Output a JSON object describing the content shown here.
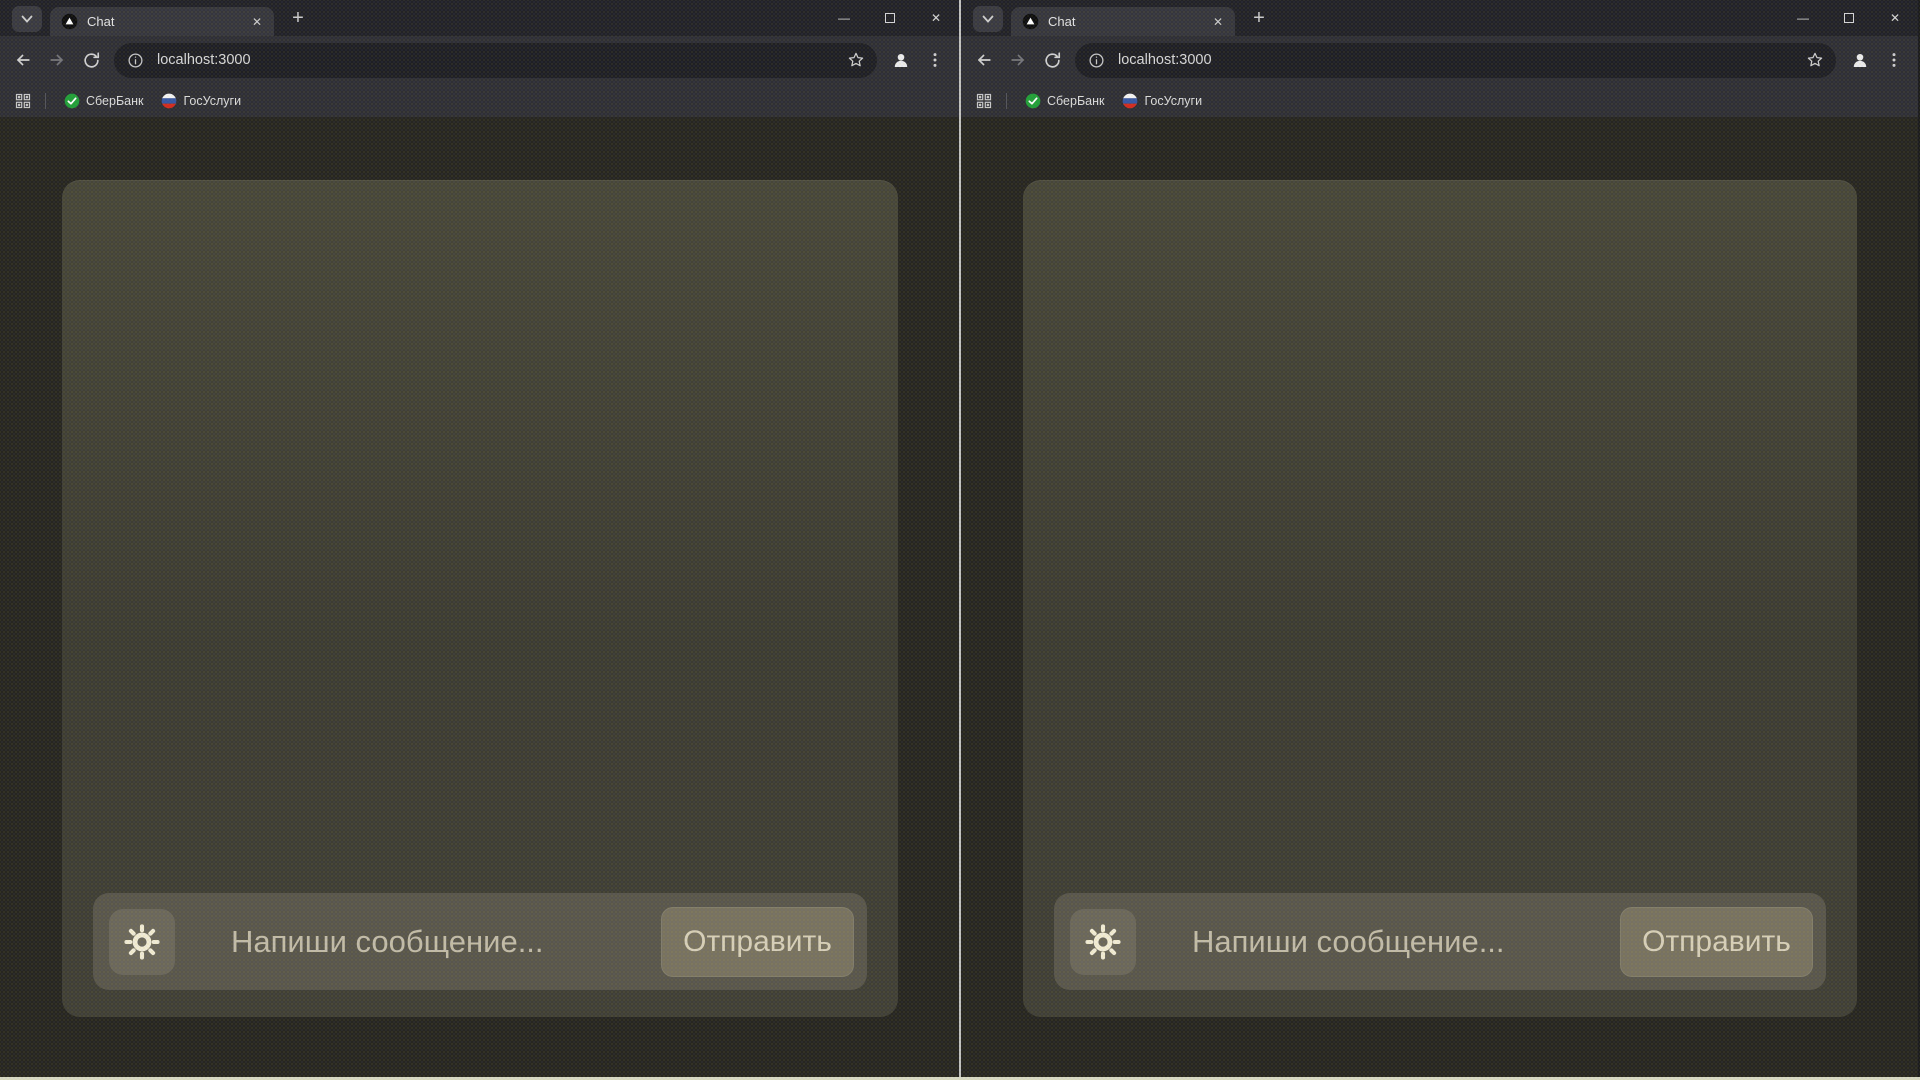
{
  "browser": {
    "tab_title": "Chat",
    "url": "localhost:3000",
    "bookmarks": [
      {
        "label": "СберБанк"
      },
      {
        "label": "ГосУслуги"
      }
    ]
  },
  "chat_app": {
    "composer": {
      "placeholder": "Напиши сообщение...",
      "send_label": "Отправить"
    }
  },
  "icons": {
    "close_glyph": "✕",
    "plus_glyph": "+",
    "minimize_glyph": "—"
  },
  "colors": {
    "tabstrip_bg": "#222227",
    "toolbar_bg": "#2f2f34",
    "omnibox_bg": "#1f1f24",
    "page_bg": "#272620",
    "chat_card_bg": "#43422f",
    "composer_bg": "#59564b",
    "send_button_bg": "#78725f",
    "accent_text": "#d8d0b9",
    "sun_icon": "#f2ecd4",
    "sber_green": "#21a038",
    "flag_blue": "#3757a5",
    "flag_red": "#d52b1e",
    "window_divider": "#c2c2c2",
    "taskbar_strip": "#d9dac3"
  }
}
